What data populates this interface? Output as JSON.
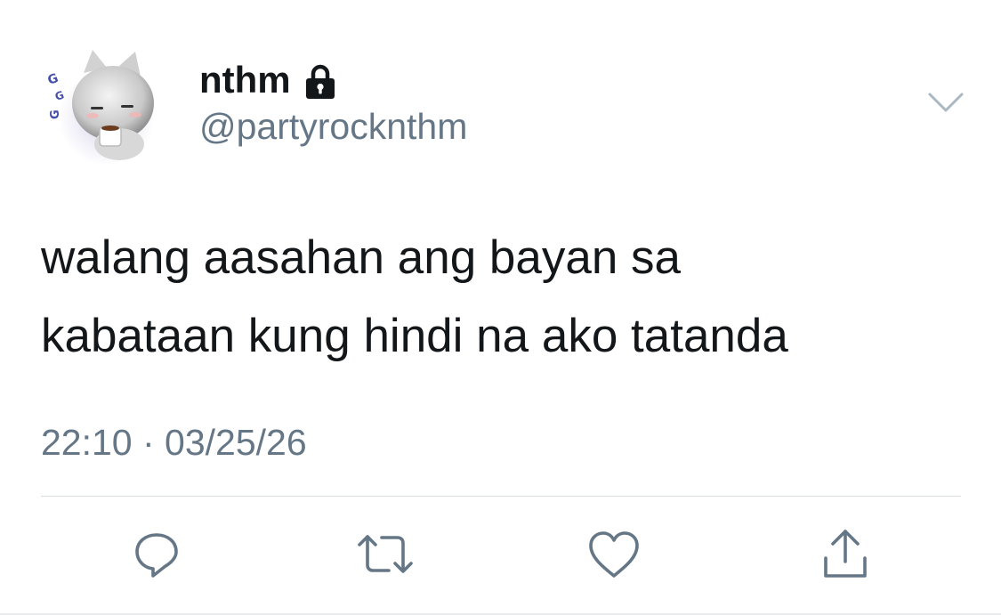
{
  "tweet": {
    "display_name": "nthm",
    "handle": "@partyrocknthm",
    "text_lines": [
      "walang aasahan ang bayan sa",
      "kabataan kung hindi na ako tatanda"
    ],
    "timestamp": "22:10 · 03/25/26",
    "avatar_letters": [
      "G",
      "G",
      "G"
    ]
  },
  "icons": {
    "account_lock": "lock-icon",
    "menu": "chevron-down-icon",
    "actions": [
      "reply-icon",
      "retweet-icon",
      "like-icon",
      "share-icon"
    ]
  },
  "colors": {
    "text": "#14171a",
    "secondary": "#657786",
    "divider": "#d7dde3",
    "background": "#ffffff"
  }
}
